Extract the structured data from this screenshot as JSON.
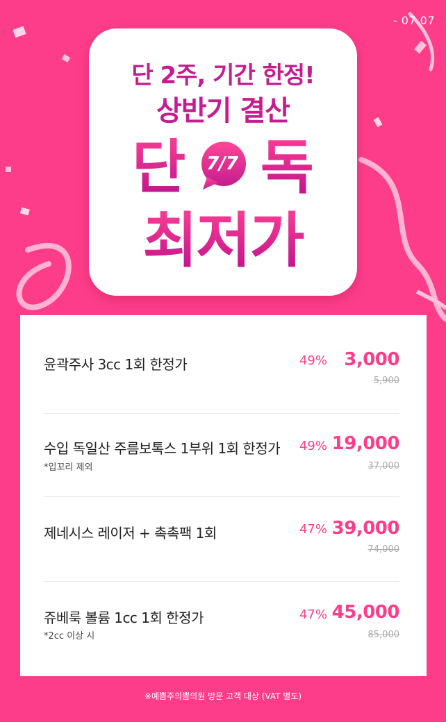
{
  "header": {
    "date": "- 07.07"
  },
  "hero": {
    "subtitle": "단 2주, 기간 한정!",
    "title": "상반기 결산",
    "big_left": "단",
    "badge": "7/7",
    "big_right": "독",
    "headline": "최저가"
  },
  "items": [
    {
      "name": "윤곽주사 3cc 1회 한정가",
      "note": "",
      "discount": "49%",
      "price": "3,000",
      "original": "5,900"
    },
    {
      "name": "수입 독일산 주름보톡스 1부위 1회 한정가",
      "note": "*입꼬리 제외",
      "discount": "49%",
      "price": "19,000",
      "original": "37,000"
    },
    {
      "name": "제네시스 레이저 + 촉촉팩 1회",
      "note": "",
      "discount": "47%",
      "price": "39,000",
      "original": "74,000"
    },
    {
      "name": "쥬베룩 볼륨 1cc 1회 한정가",
      "note": "*2cc 이상 시",
      "discount": "47%",
      "price": "45,000",
      "original": "85,000"
    }
  ],
  "footer": {
    "disclaimer": "※예쁨주의쁨의원 방문 고객 대상 (VAT 별도)"
  },
  "colors": {
    "background": "#fd3d8a",
    "accent": "#c41d8f",
    "price": "#fd3d8a"
  }
}
